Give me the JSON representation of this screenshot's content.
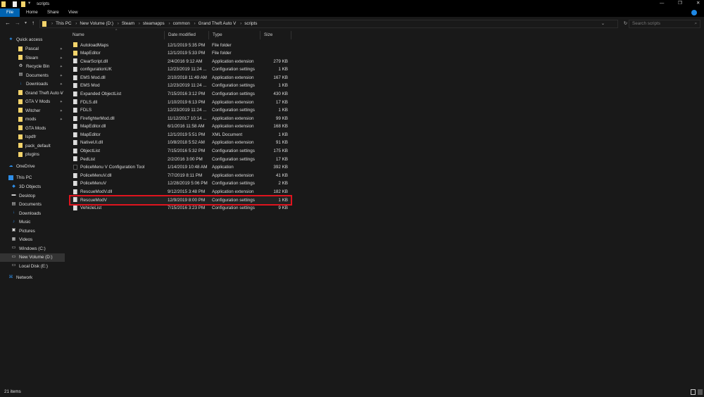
{
  "window": {
    "title": "scripts",
    "min": "—",
    "max": "❐",
    "close": "✕"
  },
  "ribbon": {
    "tabs": [
      "File",
      "Home",
      "Share",
      "View"
    ]
  },
  "address": {
    "crumbs": [
      "This PC",
      "New Volume (D:)",
      "Steam",
      "steamapps",
      "common",
      "Grand Theft Auto V",
      "scripts"
    ],
    "search_placeholder": "Search scripts"
  },
  "columns": {
    "name": "Name",
    "date": "Date modified",
    "type": "Type",
    "size": "Size"
  },
  "sidebar": {
    "quick_access": "Quick access",
    "quick": [
      {
        "label": "Pascal",
        "icon": "folder",
        "pin": true
      },
      {
        "label": "Steam",
        "icon": "folder",
        "pin": true
      },
      {
        "label": "Recycle Bin",
        "icon": "recycle",
        "pin": true
      },
      {
        "label": "Documents",
        "icon": "documents",
        "pin": true
      },
      {
        "label": "Downloads",
        "icon": "downloads",
        "pin": true
      },
      {
        "label": "Grand Theft Auto V",
        "icon": "folder",
        "pin": true
      },
      {
        "label": "GTA V Mods",
        "icon": "folder",
        "pin": true
      },
      {
        "label": "Witcher",
        "icon": "folder",
        "pin": true
      },
      {
        "label": "mods",
        "icon": "folder",
        "pin": true
      },
      {
        "label": "GTA Mods",
        "icon": "folder",
        "pin": false
      },
      {
        "label": "lspdfr",
        "icon": "folder",
        "pin": false
      },
      {
        "label": "pack_default",
        "icon": "folder",
        "pin": false
      },
      {
        "label": "plugins",
        "icon": "folder",
        "pin": false
      }
    ],
    "onedrive": "OneDrive",
    "this_pc": "This PC",
    "pc": [
      {
        "label": "3D Objects",
        "icon": "cube"
      },
      {
        "label": "Desktop",
        "icon": "desktop"
      },
      {
        "label": "Documents",
        "icon": "documents"
      },
      {
        "label": "Downloads",
        "icon": "downloads"
      },
      {
        "label": "Music",
        "icon": "music"
      },
      {
        "label": "Pictures",
        "icon": "pictures"
      },
      {
        "label": "Videos",
        "icon": "videos"
      },
      {
        "label": "Windows (C:)",
        "icon": "drive"
      },
      {
        "label": "New Volume (D:)",
        "icon": "drive",
        "selected": true
      },
      {
        "label": "Local Disk (E:)",
        "icon": "drive"
      }
    ],
    "network": "Network"
  },
  "files": [
    {
      "name": "AutoloadMaps",
      "date": "12/1/2019 5:35 PM",
      "type": "File folder",
      "size": "",
      "kind": "folder"
    },
    {
      "name": "MapEditor",
      "date": "12/1/2019 5:33 PM",
      "type": "File folder",
      "size": "",
      "kind": "folder"
    },
    {
      "name": "ClearScript.dll",
      "date": "2/4/2016 9:12 AM",
      "type": "Application extension",
      "size": "279 KB",
      "kind": "file"
    },
    {
      "name": "configurationUK",
      "date": "12/23/2019 11:24 ...",
      "type": "Configuration settings",
      "size": "1 KB",
      "kind": "file"
    },
    {
      "name": "EMS Mod.dll",
      "date": "2/10/2018 11:49 AM",
      "type": "Application extension",
      "size": "167 KB",
      "kind": "file"
    },
    {
      "name": "EMS Mod",
      "date": "12/23/2019 11:24 ...",
      "type": "Configuration settings",
      "size": "1 KB",
      "kind": "file"
    },
    {
      "name": "Expanded ObjectList",
      "date": "7/15/2016 3:12 PM",
      "type": "Configuration settings",
      "size": "430 KB",
      "kind": "file"
    },
    {
      "name": "FDLS.dll",
      "date": "1/10/2019 6:13 PM",
      "type": "Application extension",
      "size": "17 KB",
      "kind": "file"
    },
    {
      "name": "FDLS",
      "date": "12/23/2019 11:24 ...",
      "type": "Configuration settings",
      "size": "1 KB",
      "kind": "file"
    },
    {
      "name": "FirefighterMod.dll",
      "date": "11/12/2017 10:14 ...",
      "type": "Application extension",
      "size": "99 KB",
      "kind": "file"
    },
    {
      "name": "MapEditor.dll",
      "date": "6/1/2016 11:58 AM",
      "type": "Application extension",
      "size": "168 KB",
      "kind": "file"
    },
    {
      "name": "MapEditor",
      "date": "12/1/2019 5:51 PM",
      "type": "XML Document",
      "size": "1 KB",
      "kind": "file"
    },
    {
      "name": "NativeUI.dll",
      "date": "10/8/2018 5:52 AM",
      "type": "Application extension",
      "size": "91 KB",
      "kind": "file"
    },
    {
      "name": "ObjectList",
      "date": "7/15/2016 5:32 PM",
      "type": "Configuration settings",
      "size": "175 KB",
      "kind": "file"
    },
    {
      "name": "PedList",
      "date": "2/2/2016 3:00 PM",
      "type": "Configuration settings",
      "size": "17 KB",
      "kind": "file"
    },
    {
      "name": "PoliceMenu V Configuration Tool",
      "date": "1/14/2019 10:48 AM",
      "type": "Application",
      "size": "392 KB",
      "kind": "app"
    },
    {
      "name": "PoliceMenuV.dll",
      "date": "7/7/2019 8:11 PM",
      "type": "Application extension",
      "size": "41 KB",
      "kind": "file"
    },
    {
      "name": "PoliceMenuV",
      "date": "12/28/2019 5:06 PM",
      "type": "Configuration settings",
      "size": "2 KB",
      "kind": "file"
    },
    {
      "name": "RescueModV.dll",
      "date": "9/12/2015 3:48 PM",
      "type": "Application extension",
      "size": "182 KB",
      "kind": "file"
    },
    {
      "name": "RescueModV",
      "date": "12/9/2019 8:00 PM",
      "type": "Configuration settings",
      "size": "1 KB",
      "kind": "file",
      "highlight": true
    },
    {
      "name": "VehicleList",
      "date": "7/15/2016 3:23 PM",
      "type": "Configuration settings",
      "size": "9 KB",
      "kind": "file"
    }
  ],
  "status": {
    "items": "21 items"
  },
  "colors": {
    "accent": "#0063b1",
    "highlight": "#e0141e",
    "folder": "#f3d36b"
  }
}
